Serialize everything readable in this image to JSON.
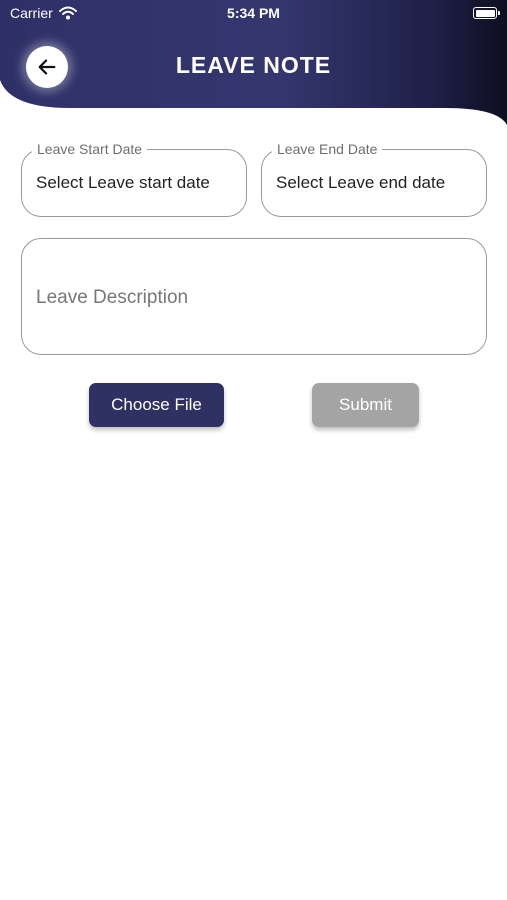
{
  "status_bar": {
    "carrier": "Carrier",
    "time": "5:34 PM"
  },
  "header": {
    "title": "LEAVE NOTE",
    "back_icon": "arrow-left-icon"
  },
  "form": {
    "start_date": {
      "label": "Leave Start Date",
      "value": "Select Leave start date"
    },
    "end_date": {
      "label": "Leave End Date",
      "value": "Select Leave end date"
    },
    "description": {
      "placeholder": "Leave Description"
    }
  },
  "actions": {
    "choose_file_label": "Choose File",
    "submit_label": "Submit"
  },
  "colors": {
    "header_primary": "#2e3067",
    "header_dark": "#0e0e22",
    "choose_button": "#2f3163",
    "submit_button_disabled": "#a4a4a4"
  }
}
